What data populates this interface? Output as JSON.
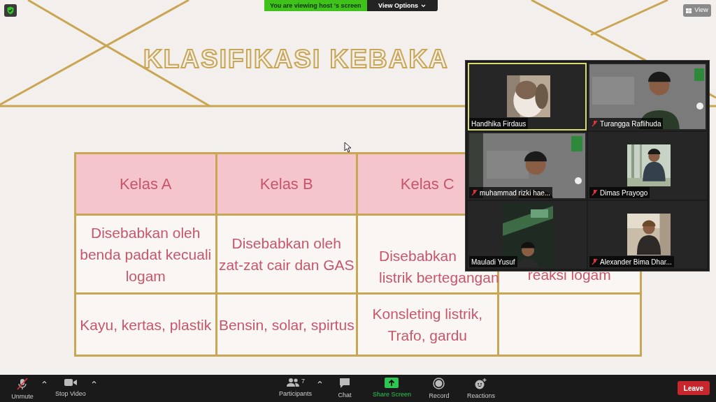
{
  "top_banner": {
    "status": "You are viewing host 's screen",
    "options_button": "View Options"
  },
  "view_button": "View",
  "slide": {
    "title": "KLASIFIKASI KEBAKA",
    "table": {
      "header": [
        "Kelas A",
        "Kelas B",
        "Kelas C"
      ],
      "rows": [
        [
          [
            "Disebabkan oleh",
            "benda padat kecuali",
            "logam"
          ],
          [
            "Disebabkan oleh",
            "zat-zat cair dan GAS"
          ],
          [
            "Disebabkan",
            "listrik bertegangan"
          ],
          [
            "reaksi logam"
          ]
        ],
        [
          [
            "Kayu, kertas, plastik"
          ],
          [
            "Bensin, solar, spirtus"
          ],
          [
            "Konsleting listrik,",
            "Trafo, gardu"
          ]
        ]
      ]
    }
  },
  "gallery": [
    {
      "name": "Handhika Firdaus",
      "muted": false,
      "active_speaker": true,
      "kind": "picture"
    },
    {
      "name": "Turangga Raflihuda",
      "muted": true,
      "active_speaker": false,
      "kind": "picture"
    },
    {
      "name": "muhammad rizki hae...",
      "muted": true,
      "active_speaker": false,
      "kind": "picture"
    },
    {
      "name": "Dimas Prayogo",
      "muted": true,
      "active_speaker": false,
      "kind": "picture"
    },
    {
      "name": "Mauladi Yusuf",
      "muted": false,
      "active_speaker": false,
      "kind": "picture"
    },
    {
      "name": "Alexander Bima Dhar...",
      "muted": true,
      "active_speaker": false,
      "kind": "picture"
    }
  ],
  "toolbar": {
    "left": [
      {
        "kind": "mic",
        "label": "Unmute",
        "muted": true,
        "has_menu": true
      },
      {
        "kind": "video",
        "label": "Stop Video",
        "has_menu": true
      }
    ],
    "center": [
      {
        "kind": "participants",
        "label": "Participants",
        "count": "7",
        "has_menu": true
      },
      {
        "kind": "chat",
        "label": "Chat",
        "has_menu": false
      },
      {
        "kind": "share",
        "label": "Share Screen",
        "has_menu": false
      },
      {
        "kind": "record",
        "label": "Record",
        "has_menu": false
      },
      {
        "kind": "reactions",
        "label": "Reactions",
        "has_menu": false
      }
    ],
    "leave_button": "Leave"
  }
}
